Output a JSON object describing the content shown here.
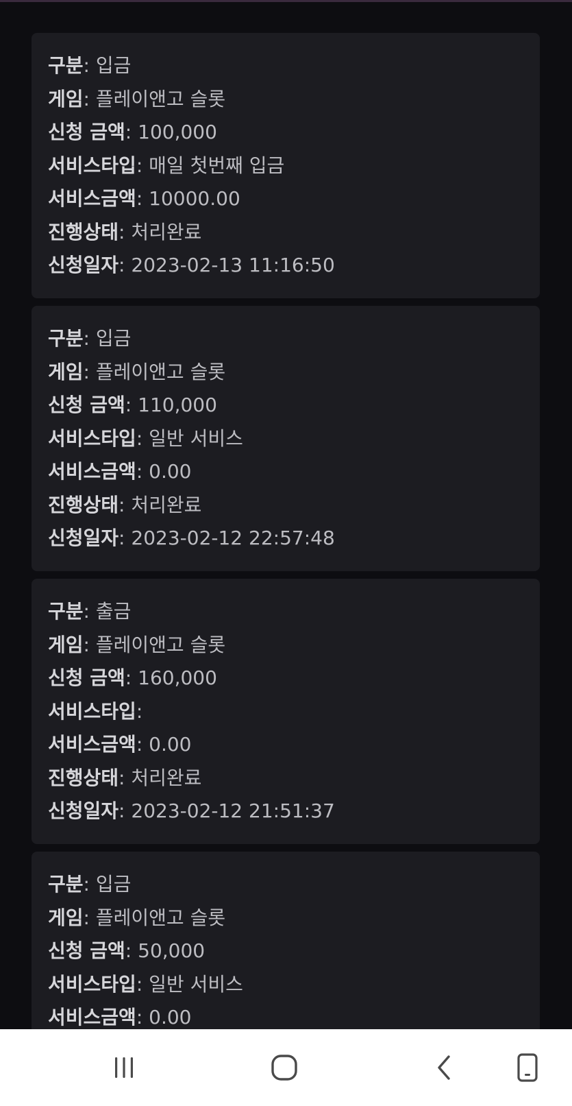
{
  "labels": {
    "category": "구분",
    "game": "게임",
    "request_amount": "신청 금액",
    "service_type": "서비스타입",
    "service_amount": "서비스금액",
    "status": "진행상태",
    "request_date": "신청일자"
  },
  "separator": ": ",
  "records": [
    {
      "category": "입금",
      "game": "플레이앤고 슬롯",
      "request_amount": "100,000",
      "service_type": "매일 첫번째 입금",
      "service_amount": "10000.00",
      "status": "처리완료",
      "request_date": "2023-02-13 11:16:50"
    },
    {
      "category": "입금",
      "game": "플레이앤고 슬롯",
      "request_amount": "110,000",
      "service_type": "일반 서비스",
      "service_amount": "0.00",
      "status": "처리완료",
      "request_date": "2023-02-12 22:57:48"
    },
    {
      "category": "출금",
      "game": "플레이앤고 슬롯",
      "request_amount": "160,000",
      "service_type": "",
      "service_amount": "0.00",
      "status": "처리완료",
      "request_date": "2023-02-12 21:51:37"
    },
    {
      "category": "입금",
      "game": "플레이앤고 슬롯",
      "request_amount": "50,000",
      "service_type": "일반 서비스",
      "service_amount": "0.00",
      "status": "",
      "request_date": ""
    }
  ],
  "navbar": {
    "recents_icon": "recents-icon",
    "home_icon": "home-icon",
    "back_icon": "back-icon",
    "rotate_icon": "rotate-screen-icon",
    "icon_color": "#4a4a4a"
  }
}
